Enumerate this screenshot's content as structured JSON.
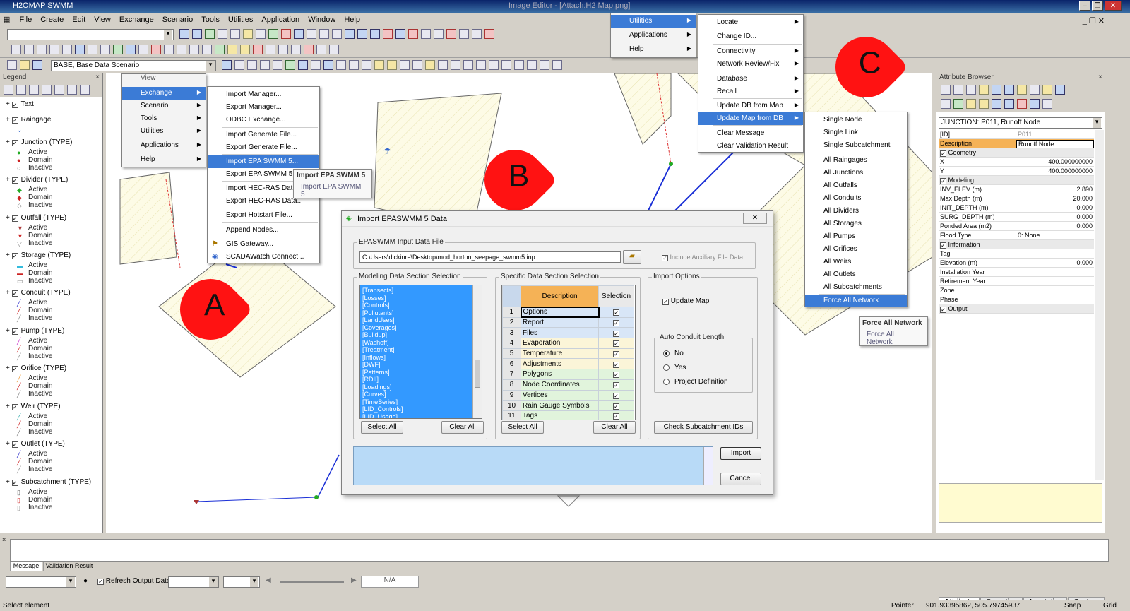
{
  "app": {
    "title": "H2OMAP SWMM",
    "caption": "Image Editor - [Attach:H2 Map.png]"
  },
  "menubar": [
    "File",
    "Create",
    "Edit",
    "View",
    "Exchange",
    "Scenario",
    "Tools",
    "Utilities",
    "Application",
    "Window",
    "Help"
  ],
  "toolbar": {
    "scenario": "BASE, Base Data Scenario"
  },
  "legend": {
    "title": "Legend",
    "groups": [
      {
        "label": "Text",
        "subs": []
      },
      {
        "label": "Raingage",
        "subs": []
      },
      {
        "label": "Junction (TYPE)",
        "subs": [
          "Active",
          "Domain",
          "Inactive"
        ]
      },
      {
        "label": "Divider (TYPE)",
        "subs": [
          "Active",
          "Domain",
          "Inactive"
        ]
      },
      {
        "label": "Outfall (TYPE)",
        "subs": [
          "Active",
          "Domain",
          "Inactive"
        ]
      },
      {
        "label": "Storage (TYPE)",
        "subs": [
          "Active",
          "Domain",
          "Inactive"
        ]
      },
      {
        "label": "Conduit (TYPE)",
        "subs": [
          "Active",
          "Domain",
          "Inactive"
        ]
      },
      {
        "label": "Pump (TYPE)",
        "subs": [
          "Active",
          "Domain",
          "Inactive"
        ]
      },
      {
        "label": "Orifice (TYPE)",
        "subs": [
          "Active",
          "Domain",
          "Inactive"
        ]
      },
      {
        "label": "Weir (TYPE)",
        "subs": [
          "Active",
          "Domain",
          "Inactive"
        ]
      },
      {
        "label": "Outlet (TYPE)",
        "subs": [
          "Active",
          "Domain",
          "Inactive"
        ]
      },
      {
        "label": "Subcatchment (TYPE)",
        "subs": [
          "Active",
          "Domain",
          "Inactive"
        ]
      }
    ]
  },
  "menuA": {
    "parent": [
      "View",
      "Exchange",
      "Scenario",
      "Tools",
      "Utilities",
      "Applications",
      "Help"
    ],
    "items": [
      "Import Manager...",
      "Export Manager...",
      "ODBC Exchange...",
      "Import Generate File...",
      "Export Generate File...",
      "Import EPA SWMM 5...",
      "Export EPA SWMM 5...",
      "Import HEC-RAS Data...",
      "Export HEC-RAS Data...",
      "Export Hotstart File...",
      "Append Nodes...",
      "GIS Gateway...",
      "SCADAWatch Connect..."
    ],
    "tooltip": {
      "title": "Import EPA SWMM 5",
      "body": "Import EPA SWMM 5"
    }
  },
  "menuC": {
    "parent": [
      "Utilities",
      "Applications",
      "Help"
    ],
    "utilities": [
      "Locate",
      "Change ID...",
      "Connectivity",
      "Network Review/Fix",
      "Database",
      "Recall",
      "Update DB from Map",
      "Update Map from DB",
      "Clear Message",
      "Clear Validation Result"
    ],
    "sub": [
      "Single Node",
      "Single Link",
      "Single Subcatchment",
      "All Raingages",
      "All Junctions",
      "All Outfalls",
      "All Conduits",
      "All Dividers",
      "All Storages",
      "All Pumps",
      "All Orifices",
      "All Weirs",
      "All Outlets",
      "All Subcatchments",
      "Force All Network"
    ],
    "tooltip": {
      "title": "Force All Network",
      "body": "Force All Network"
    }
  },
  "badges": [
    "A",
    "B",
    "C"
  ],
  "dialog": {
    "title": "Import EPASWMM 5 Data",
    "input_group": "EPASWMM Input Data File",
    "path": "C:\\Users\\dickinre\\Desktop\\mod_horton_seepage_swmm5.inp",
    "aux": "Include Auxiliary File Data",
    "modeling_group": "Modeling Data Section Selection",
    "sections": [
      "[Transects]",
      "[Losses]",
      "[Controls]",
      "[Pollutants]",
      "[LandUses]",
      "[Coverages]",
      "[Buildup]",
      "[Washoff]",
      "[Treatment]",
      "[Inflows]",
      "[DWF]",
      "[Patterns]",
      "[RDII]",
      "[Loadings]",
      "[Curves]",
      "[TimeSeries]",
      "[LID_Controls]",
      "[LID_Usage]"
    ],
    "specific_group": "Specific Data Section Selection",
    "col_desc": "Description",
    "col_sel": "Selection",
    "rows": [
      {
        "n": "1",
        "d": "Options"
      },
      {
        "n": "2",
        "d": "Report"
      },
      {
        "n": "3",
        "d": "Files"
      },
      {
        "n": "4",
        "d": "Evaporation"
      },
      {
        "n": "5",
        "d": "Temperature"
      },
      {
        "n": "6",
        "d": "Adjustments"
      },
      {
        "n": "7",
        "d": "Polygons"
      },
      {
        "n": "8",
        "d": "Node Coordinates"
      },
      {
        "n": "9",
        "d": "Vertices"
      },
      {
        "n": "10",
        "d": "Rain Gauge Symbols"
      },
      {
        "n": "11",
        "d": "Tags"
      }
    ],
    "select_all": "Select All",
    "clear_all": "Clear All",
    "options_group": "Import Options",
    "update_map": "Update Map",
    "auto_group": "Auto Conduit Length",
    "no": "No",
    "yes": "Yes",
    "proj": "Project Definition",
    "check": "Check Subcatchment IDs",
    "import": "Import",
    "cancel": "Cancel"
  },
  "attr": {
    "title": "Attribute Browser",
    "selector": "JUNCTION: P011, Runoff Node",
    "rows": [
      {
        "k": "[ID]",
        "v": "P011",
        "t": "gray"
      },
      {
        "k": "Description",
        "v": "Runoff Node",
        "t": "sel"
      },
      {
        "k": "Geometry",
        "v": "",
        "t": "grp"
      },
      {
        "k": "X",
        "v": "400.000000000",
        "t": ""
      },
      {
        "k": "Y",
        "v": "400.000000000",
        "t": ""
      },
      {
        "k": "Modeling",
        "v": "",
        "t": "grp"
      },
      {
        "k": "INV_ELEV (m)",
        "v": "2.890",
        "t": ""
      },
      {
        "k": "Max Depth (m)",
        "v": "20.000",
        "t": ""
      },
      {
        "k": "INIT_DEPTH (m)",
        "v": "0.000",
        "t": ""
      },
      {
        "k": "SURG_DEPTH (m)",
        "v": "0.000",
        "t": ""
      },
      {
        "k": "Ponded Area (m2)",
        "v": "0.000",
        "t": ""
      },
      {
        "k": "Flood Type",
        "v": "0: None",
        "t": "left"
      },
      {
        "k": "Information",
        "v": "",
        "t": "grp"
      },
      {
        "k": "Tag",
        "v": "",
        "t": ""
      },
      {
        "k": "Elevation (m)",
        "v": "0.000",
        "t": ""
      },
      {
        "k": "Installation Year",
        "v": "",
        "t": ""
      },
      {
        "k": "Retirement Year",
        "v": "",
        "t": ""
      },
      {
        "k": "Zone",
        "v": "",
        "t": ""
      },
      {
        "k": "Phase",
        "v": "",
        "t": ""
      },
      {
        "k": "Output",
        "v": "",
        "t": "grp"
      }
    ],
    "tabs": [
      "Attribute",
      "Operation",
      "Annotation",
      "Contour"
    ]
  },
  "bottom": {
    "tabs": [
      "Message",
      "Validation Result"
    ],
    "refresh": "Refresh Output Data",
    "na": "N/A"
  },
  "status": {
    "left": "Select element",
    "mode": "Pointer",
    "coords": "901.93395862, 505.79745937",
    "snap": "Snap",
    "grid": "Grid"
  }
}
